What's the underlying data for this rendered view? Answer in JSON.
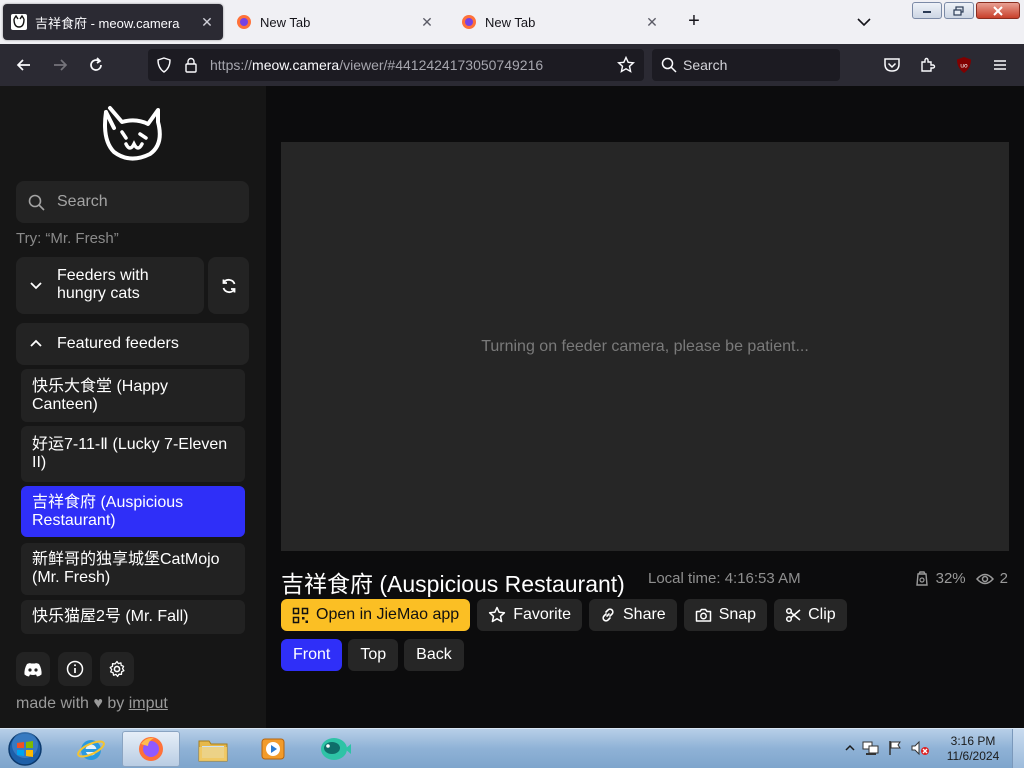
{
  "browser": {
    "tabs": [
      {
        "title": "吉祥食府 - meow.camera",
        "active": true
      },
      {
        "title": "New Tab",
        "active": false
      },
      {
        "title": "New Tab",
        "active": false
      }
    ],
    "url": {
      "scheme": "https://",
      "host": "meow.camera",
      "path": "/viewer/#4412424173050749216"
    },
    "search_placeholder": "Search",
    "ublock_badge": "uo"
  },
  "sidebar": {
    "search_placeholder": "Search",
    "hint": "Try: “Mr. Fresh”",
    "hungry_section": {
      "label": "Feeders with hungry cats",
      "expanded": false
    },
    "featured_section": {
      "label": "Featured feeders",
      "expanded": true
    },
    "featured_feeders": [
      {
        "name": "快乐大食堂 (Happy Canteen)",
        "selected": false
      },
      {
        "name": "好运7-11-Ⅱ (Lucky 7-Eleven II)",
        "selected": false
      },
      {
        "name": "吉祥食府 (Auspicious Restaurant)",
        "selected": true
      },
      {
        "name": "新鲜哥的独享城堡CatMojo (Mr. Fresh)",
        "selected": false
      },
      {
        "name": "快乐猫屋2号 (Mr. Fall)",
        "selected": false
      }
    ],
    "footer": {
      "made_with": "made with",
      "by": "by",
      "author": "imput"
    },
    "icons": [
      "discord-icon",
      "info-icon",
      "settings-icon"
    ]
  },
  "viewer": {
    "status_message": "Turning on feeder camera, please be patient...",
    "feeder_title": "吉祥食府 (Auspicious Restaurant)",
    "local_time": "Local time: 4:16:53 AM",
    "food_level": "32%",
    "viewers": "2",
    "actions": {
      "open_app": "Open in JieMao app",
      "favorite": "Favorite",
      "share": "Share",
      "snap": "Snap",
      "clip": "Clip"
    },
    "camera_views": [
      {
        "label": "Front",
        "selected": true
      },
      {
        "label": "Top",
        "selected": false
      },
      {
        "label": "Back",
        "selected": false
      }
    ]
  },
  "taskbar": {
    "time": "3:16 PM",
    "date": "11/6/2024"
  },
  "colors": {
    "accent_blue": "#2f2ff8",
    "accent_yellow": "#fbbf24",
    "sidebar_bg": "#161616",
    "panel_bg": "#232323"
  }
}
